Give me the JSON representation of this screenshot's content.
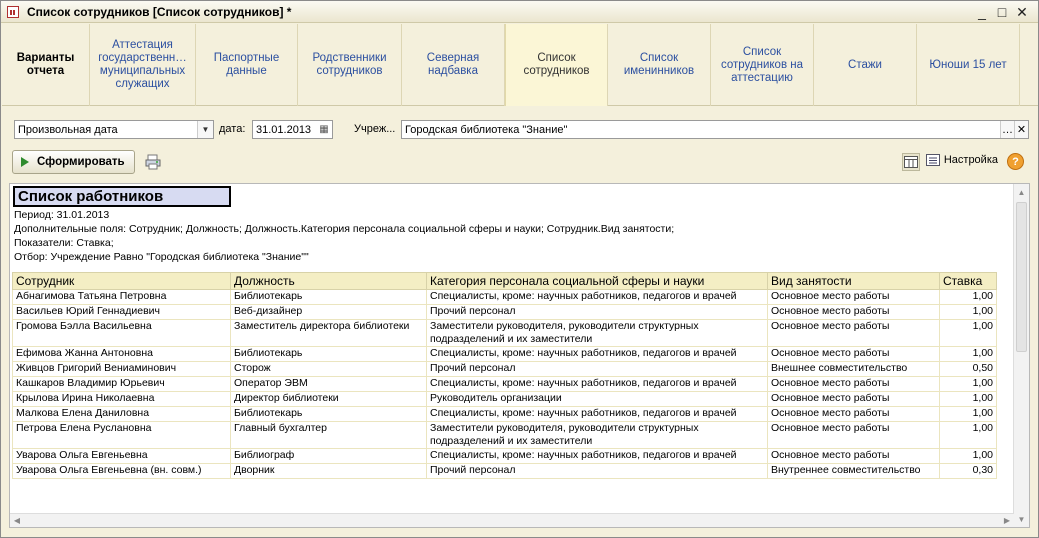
{
  "window": {
    "title": "Список сотрудников [Список сотрудников] *",
    "minimize": "_",
    "maximize": "□",
    "close": "✕"
  },
  "variants": {
    "header": "Варианты отчета",
    "tabs": [
      "Аттестация государственн… муниципальных служащих",
      "Паспортные данные",
      "Родственники сотрудников",
      "Северная надбавка",
      "Список сотрудников",
      "Список именинников",
      "Список сотрудников на аттестацию",
      "Стажи",
      "Юноши 15 лет"
    ],
    "active_index": 4
  },
  "params": {
    "period_type": "Произвольная дата",
    "date_label": "дата:",
    "date_value": "31.01.2013",
    "org_label": "Учреж...",
    "org_value": "Городская библиотека \"Знание\""
  },
  "toolbar": {
    "generate_label": "Сформировать",
    "settings_label": "Настройка",
    "help_label": "?"
  },
  "report": {
    "title": "Список работников",
    "period": "Период: 31.01.2013",
    "extra_fields": "Дополнительные поля: Сотрудник; Должность; Должность.Категория персонала социальной сферы и науки; Сотрудник.Вид занятости;",
    "indicators": "Показатели: Ставка;",
    "filter": "Отбор: Учреждение Равно \"Городская библиотека \"Знание\"\"",
    "columns": [
      "Сотрудник",
      "Должность",
      "Категория персонала социальной сферы и науки",
      "Вид занятости",
      "Ставка"
    ],
    "rows": [
      [
        "Абнагимова Татьяна Петровна",
        "Библиотекарь",
        "Специалисты, кроме: научных работников, педагогов и врачей",
        "Основное место работы",
        "1,00"
      ],
      [
        "Васильев Юрий Геннадиевич",
        "Веб-дизайнер",
        "Прочий персонал",
        "Основное место работы",
        "1,00"
      ],
      [
        "Громова Бэлла Васильевна",
        "Заместитель директора библиотеки",
        "Заместители руководителя, руководители структурных подразделений и их заместители",
        "Основное место работы",
        "1,00"
      ],
      [
        "Ефимова Жанна Антоновна",
        "Библиотекарь",
        "Специалисты, кроме: научных работников, педагогов и врачей",
        "Основное место работы",
        "1,00"
      ],
      [
        "Живцов Григорий Вениаминович",
        "Сторож",
        "Прочий персонал",
        "Внешнее совместительство",
        "0,50"
      ],
      [
        "Кашкаров Владимир Юрьевич",
        "Оператор ЭВМ",
        "Специалисты, кроме: научных работников, педагогов и врачей",
        "Основное место работы",
        "1,00"
      ],
      [
        "Крылова Ирина Николаевна",
        "Директор библиотеки",
        "Руководитель организации",
        "Основное место работы",
        "1,00"
      ],
      [
        "Малкова Елена Даниловна",
        "Библиотекарь",
        "Специалисты, кроме: научных работников, педагогов и врачей",
        "Основное место работы",
        "1,00"
      ],
      [
        "Петрова Елена Руслановна",
        "Главный бухгалтер",
        "Заместители руководителя, руководители структурных подразделений и их заместители",
        "Основное место работы",
        "1,00"
      ],
      [
        "Уварова Ольга Евгеньевна",
        "Библиограф",
        "Специалисты, кроме: научных работников, педагогов и врачей",
        "Основное место работы",
        "1,00"
      ],
      [
        "Уварова Ольга Евгеньевна (вн. совм.)",
        "Дворник",
        "Прочий персонал",
        "Внутреннее совместительство",
        "0,30"
      ]
    ]
  }
}
